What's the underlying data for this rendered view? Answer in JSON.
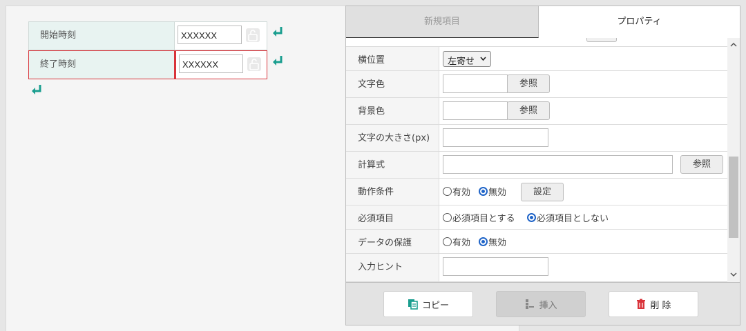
{
  "form": {
    "rows": [
      {
        "label": "開始時刻",
        "value": "XXXXXX"
      },
      {
        "label": "終了時刻",
        "value": "XXXXXX"
      }
    ]
  },
  "tabs": {
    "new_item": "新規項目",
    "properties": "プロパティ"
  },
  "props": {
    "h_align": {
      "label": "横位置",
      "value": "左寄せ"
    },
    "text_color": {
      "label": "文字色",
      "button": "参照"
    },
    "bg_color": {
      "label": "背景色",
      "button": "参照"
    },
    "font_size": {
      "label": "文字の大きさ(px)"
    },
    "formula": {
      "label": "計算式",
      "button": "参照"
    },
    "action": {
      "label": "動作条件",
      "on": "有効",
      "off": "無効",
      "button": "設定"
    },
    "required": {
      "label": "必須項目",
      "on": "必須項目とする",
      "off": "必須項目としない"
    },
    "protect": {
      "label": "データの保護",
      "on": "有効",
      "off": "無効"
    },
    "hint": {
      "label": "入力ヒント"
    }
  },
  "footer": {
    "copy": "コピー",
    "insert": "挿入",
    "delete": "削 除"
  },
  "colors": {
    "accent": "#1a9e8f",
    "selected_border": "#d9333a",
    "radio": "#1f64c8",
    "delete": "#d9333a"
  }
}
